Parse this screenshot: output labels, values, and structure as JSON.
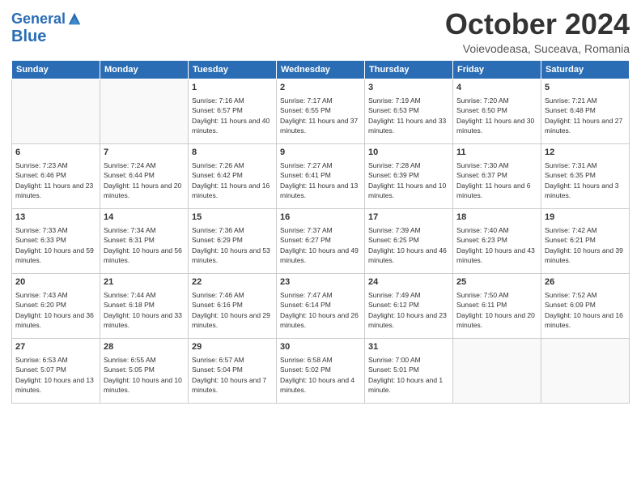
{
  "header": {
    "logo_line1": "General",
    "logo_line2": "Blue",
    "month": "October 2024",
    "location": "Voievodeasa, Suceava, Romania"
  },
  "weekdays": [
    "Sunday",
    "Monday",
    "Tuesday",
    "Wednesday",
    "Thursday",
    "Friday",
    "Saturday"
  ],
  "weeks": [
    [
      {
        "day": "",
        "info": ""
      },
      {
        "day": "",
        "info": ""
      },
      {
        "day": "1",
        "info": "Sunrise: 7:16 AM\nSunset: 6:57 PM\nDaylight: 11 hours and 40 minutes."
      },
      {
        "day": "2",
        "info": "Sunrise: 7:17 AM\nSunset: 6:55 PM\nDaylight: 11 hours and 37 minutes."
      },
      {
        "day": "3",
        "info": "Sunrise: 7:19 AM\nSunset: 6:53 PM\nDaylight: 11 hours and 33 minutes."
      },
      {
        "day": "4",
        "info": "Sunrise: 7:20 AM\nSunset: 6:50 PM\nDaylight: 11 hours and 30 minutes."
      },
      {
        "day": "5",
        "info": "Sunrise: 7:21 AM\nSunset: 6:48 PM\nDaylight: 11 hours and 27 minutes."
      }
    ],
    [
      {
        "day": "6",
        "info": "Sunrise: 7:23 AM\nSunset: 6:46 PM\nDaylight: 11 hours and 23 minutes."
      },
      {
        "day": "7",
        "info": "Sunrise: 7:24 AM\nSunset: 6:44 PM\nDaylight: 11 hours and 20 minutes."
      },
      {
        "day": "8",
        "info": "Sunrise: 7:26 AM\nSunset: 6:42 PM\nDaylight: 11 hours and 16 minutes."
      },
      {
        "day": "9",
        "info": "Sunrise: 7:27 AM\nSunset: 6:41 PM\nDaylight: 11 hours and 13 minutes."
      },
      {
        "day": "10",
        "info": "Sunrise: 7:28 AM\nSunset: 6:39 PM\nDaylight: 11 hours and 10 minutes."
      },
      {
        "day": "11",
        "info": "Sunrise: 7:30 AM\nSunset: 6:37 PM\nDaylight: 11 hours and 6 minutes."
      },
      {
        "day": "12",
        "info": "Sunrise: 7:31 AM\nSunset: 6:35 PM\nDaylight: 11 hours and 3 minutes."
      }
    ],
    [
      {
        "day": "13",
        "info": "Sunrise: 7:33 AM\nSunset: 6:33 PM\nDaylight: 10 hours and 59 minutes."
      },
      {
        "day": "14",
        "info": "Sunrise: 7:34 AM\nSunset: 6:31 PM\nDaylight: 10 hours and 56 minutes."
      },
      {
        "day": "15",
        "info": "Sunrise: 7:36 AM\nSunset: 6:29 PM\nDaylight: 10 hours and 53 minutes."
      },
      {
        "day": "16",
        "info": "Sunrise: 7:37 AM\nSunset: 6:27 PM\nDaylight: 10 hours and 49 minutes."
      },
      {
        "day": "17",
        "info": "Sunrise: 7:39 AM\nSunset: 6:25 PM\nDaylight: 10 hours and 46 minutes."
      },
      {
        "day": "18",
        "info": "Sunrise: 7:40 AM\nSunset: 6:23 PM\nDaylight: 10 hours and 43 minutes."
      },
      {
        "day": "19",
        "info": "Sunrise: 7:42 AM\nSunset: 6:21 PM\nDaylight: 10 hours and 39 minutes."
      }
    ],
    [
      {
        "day": "20",
        "info": "Sunrise: 7:43 AM\nSunset: 6:20 PM\nDaylight: 10 hours and 36 minutes."
      },
      {
        "day": "21",
        "info": "Sunrise: 7:44 AM\nSunset: 6:18 PM\nDaylight: 10 hours and 33 minutes."
      },
      {
        "day": "22",
        "info": "Sunrise: 7:46 AM\nSunset: 6:16 PM\nDaylight: 10 hours and 29 minutes."
      },
      {
        "day": "23",
        "info": "Sunrise: 7:47 AM\nSunset: 6:14 PM\nDaylight: 10 hours and 26 minutes."
      },
      {
        "day": "24",
        "info": "Sunrise: 7:49 AM\nSunset: 6:12 PM\nDaylight: 10 hours and 23 minutes."
      },
      {
        "day": "25",
        "info": "Sunrise: 7:50 AM\nSunset: 6:11 PM\nDaylight: 10 hours and 20 minutes."
      },
      {
        "day": "26",
        "info": "Sunrise: 7:52 AM\nSunset: 6:09 PM\nDaylight: 10 hours and 16 minutes."
      }
    ],
    [
      {
        "day": "27",
        "info": "Sunrise: 6:53 AM\nSunset: 5:07 PM\nDaylight: 10 hours and 13 minutes."
      },
      {
        "day": "28",
        "info": "Sunrise: 6:55 AM\nSunset: 5:05 PM\nDaylight: 10 hours and 10 minutes."
      },
      {
        "day": "29",
        "info": "Sunrise: 6:57 AM\nSunset: 5:04 PM\nDaylight: 10 hours and 7 minutes."
      },
      {
        "day": "30",
        "info": "Sunrise: 6:58 AM\nSunset: 5:02 PM\nDaylight: 10 hours and 4 minutes."
      },
      {
        "day": "31",
        "info": "Sunrise: 7:00 AM\nSunset: 5:01 PM\nDaylight: 10 hours and 1 minute."
      },
      {
        "day": "",
        "info": ""
      },
      {
        "day": "",
        "info": ""
      }
    ]
  ]
}
